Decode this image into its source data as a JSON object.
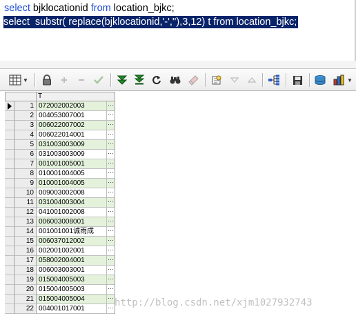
{
  "editor": {
    "line1": {
      "kw1": "select",
      "mid": " bjklocationid ",
      "kw2": "from",
      "tail": " location_bjkc;"
    },
    "line2": "select  substr( replace(bjklocationid,'-',''),3,12) t from location_bjkc;"
  },
  "toolbar": {
    "icons": [
      "grid-menu-icon",
      "lock-icon",
      "add-record-icon",
      "delete-record-icon",
      "post-edit-icon",
      "fetch-next-icon",
      "fetch-last-icon",
      "refresh-icon",
      "find-icon",
      "clear-icon",
      "query-by-example-icon",
      "filter-icon",
      "sort-icon",
      "tree-icon",
      "save-icon",
      "export-icon",
      "chart-icon"
    ]
  },
  "grid": {
    "column_header": "T",
    "ellipsis": "···",
    "rows": [
      {
        "n": "1",
        "v": "072002002003"
      },
      {
        "n": "2",
        "v": "004053007001"
      },
      {
        "n": "3",
        "v": "006022007002"
      },
      {
        "n": "4",
        "v": "006022014001"
      },
      {
        "n": "5",
        "v": "031003003009"
      },
      {
        "n": "6",
        "v": "031003003009"
      },
      {
        "n": "7",
        "v": "001001005001"
      },
      {
        "n": "8",
        "v": "010001004005"
      },
      {
        "n": "9",
        "v": "010001004005"
      },
      {
        "n": "10",
        "v": "009003002008"
      },
      {
        "n": "11",
        "v": "031004003004"
      },
      {
        "n": "12",
        "v": "041001002008"
      },
      {
        "n": "13",
        "v": "006003008001"
      },
      {
        "n": "14",
        "v": "001001001诚雨成"
      },
      {
        "n": "15",
        "v": "006037012002"
      },
      {
        "n": "16",
        "v": "002001002001"
      },
      {
        "n": "17",
        "v": "058002004001"
      },
      {
        "n": "18",
        "v": "006003003001"
      },
      {
        "n": "19",
        "v": "015004005003"
      },
      {
        "n": "20",
        "v": "015004005003"
      },
      {
        "n": "21",
        "v": "015004005004"
      },
      {
        "n": "22",
        "v": "004001017001"
      }
    ]
  },
  "watermark": "http://blog.csdn.net/xjm1027932743"
}
